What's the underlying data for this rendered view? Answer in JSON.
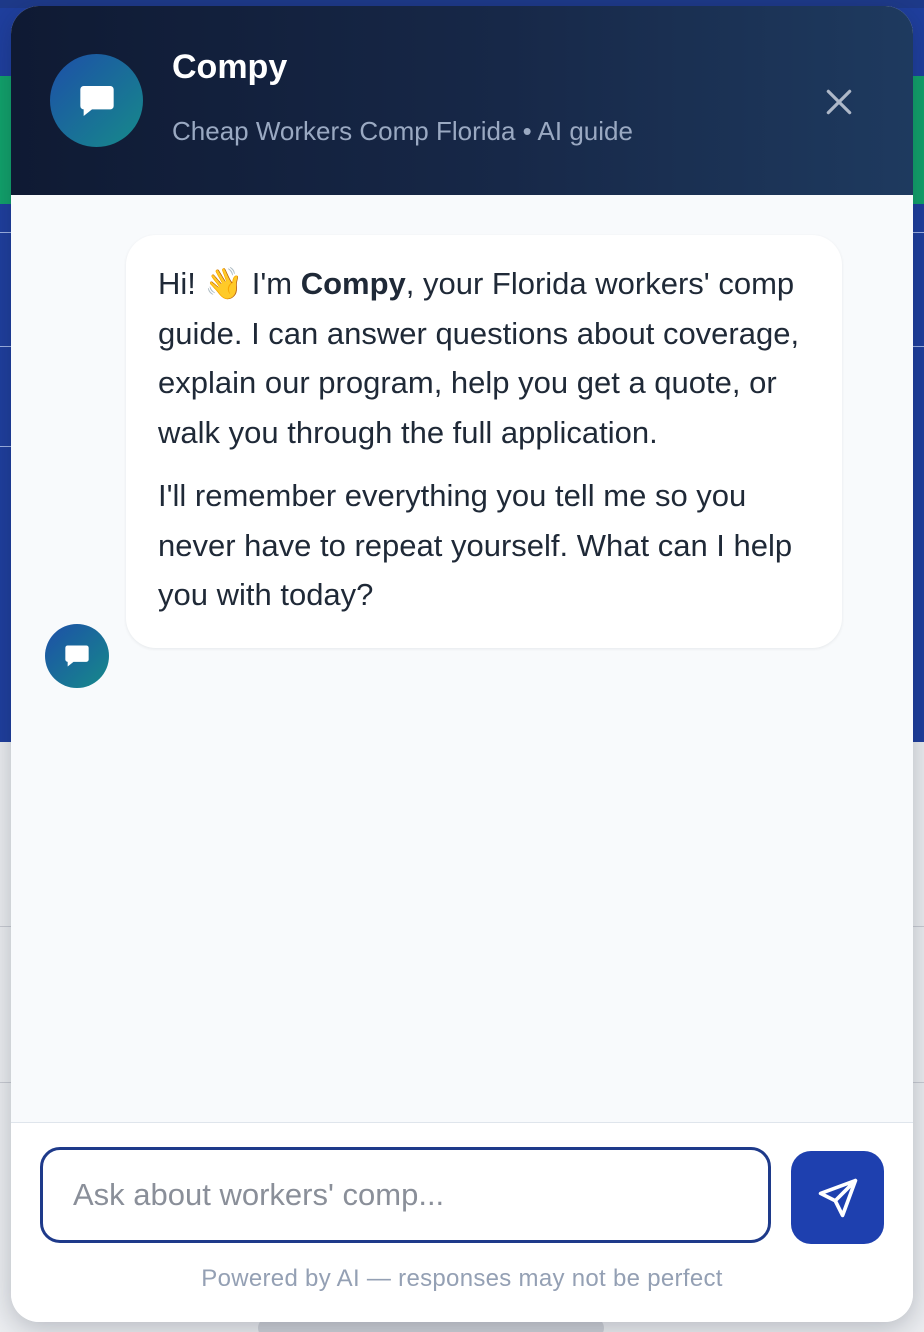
{
  "header": {
    "title": "Compy",
    "subtitle": "Cheap Workers Comp Florida • AI guide",
    "avatar_icon": "chat-bubble-icon",
    "close_icon": "close-icon"
  },
  "messages": [
    {
      "sender": "bot",
      "avatar_icon": "chat-bubble-icon",
      "greeting_prefix": "Hi! 👋 I'm ",
      "bot_name": "Compy",
      "greeting_suffix": ", your Florida workers' comp guide. I can answer questions about coverage, explain our program, help you get a quote, or walk you through the full application.",
      "paragraph_2": "I'll remember everything you tell me so you never have to repeat yourself. What can I help you with today?"
    }
  ],
  "composer": {
    "placeholder": "Ask about workers' comp...",
    "value": "",
    "send_icon": "send-icon",
    "disclaimer": "Powered by AI — responses may not be perfect"
  },
  "colors": {
    "header_bg": "#0f1a33",
    "accent": "#1e40af",
    "avatar_gradient_start": "#1d4fa8",
    "avatar_gradient_end": "#168a8a"
  }
}
